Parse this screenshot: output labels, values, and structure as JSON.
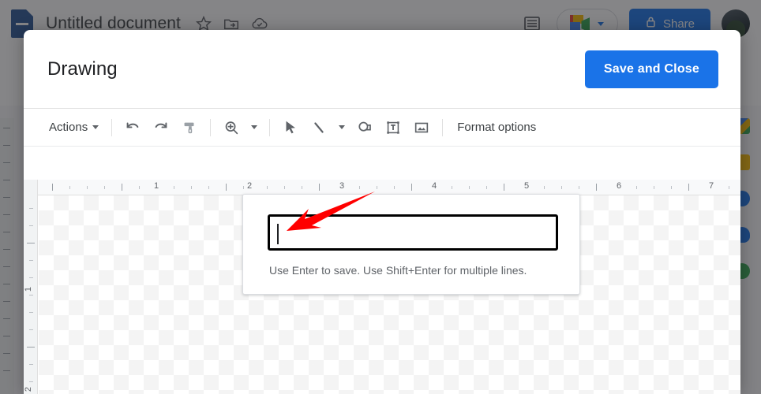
{
  "background_app": {
    "document_title": "Untitled document",
    "title_icons": [
      {
        "name": "star-icon",
        "glyph": "star"
      },
      {
        "name": "move-to-folder-icon",
        "glyph": "folder-move"
      },
      {
        "name": "cloud-saved-icon",
        "glyph": "cloud-check"
      }
    ],
    "right_controls": {
      "comment_history_label": "comment-history",
      "meet_label": "meet",
      "share_label": "Share",
      "share_color": "#1a73e8",
      "avatar_label": "account-avatar"
    },
    "side_panel_items": [
      {
        "name": "google-calendar-icon",
        "color": "#4285f4"
      },
      {
        "name": "google-keep-icon",
        "color": "#fbbc04"
      },
      {
        "name": "google-tasks-icon",
        "color": "#1a73e8"
      },
      {
        "name": "google-contacts-icon",
        "color": "#1a73e8"
      },
      {
        "name": "google-maps-icon",
        "color": "#34a853"
      }
    ]
  },
  "dialog": {
    "title": "Drawing",
    "save_close_label": "Save and Close",
    "accent_color": "#1a73e8",
    "toolbar": {
      "actions_label": "Actions",
      "format_options_label": "Format options",
      "items": [
        {
          "name": "actions-menu",
          "label": "Actions",
          "type": "menu"
        },
        {
          "name": "undo-icon",
          "label": "Undo",
          "type": "icon"
        },
        {
          "name": "redo-icon",
          "label": "Redo",
          "type": "icon"
        },
        {
          "name": "paint-format-icon",
          "label": "Paint format",
          "type": "icon"
        },
        {
          "name": "zoom-icon",
          "label": "Zoom",
          "type": "icon-menu"
        },
        {
          "name": "select-cursor-icon",
          "label": "Select",
          "type": "icon"
        },
        {
          "name": "line-icon",
          "label": "Line",
          "type": "icon-menu"
        },
        {
          "name": "shape-icon",
          "label": "Shape",
          "type": "icon"
        },
        {
          "name": "text-box-icon",
          "label": "Text box",
          "type": "icon"
        },
        {
          "name": "image-icon",
          "label": "Image",
          "type": "icon"
        }
      ]
    },
    "ruler": {
      "horizontal_labels": [
        "1",
        "2",
        "3",
        "4",
        "5",
        "6",
        "7"
      ],
      "vertical_labels": [
        "1",
        "2"
      ],
      "unit": "inches"
    }
  },
  "text_popup": {
    "input_value": "",
    "input_placeholder": "",
    "help_text": "Use Enter to save. Use Shift+Enter for multiple lines."
  },
  "annotation": {
    "arrow_color": "#ff0000",
    "arrow_target": "text-input-field"
  }
}
